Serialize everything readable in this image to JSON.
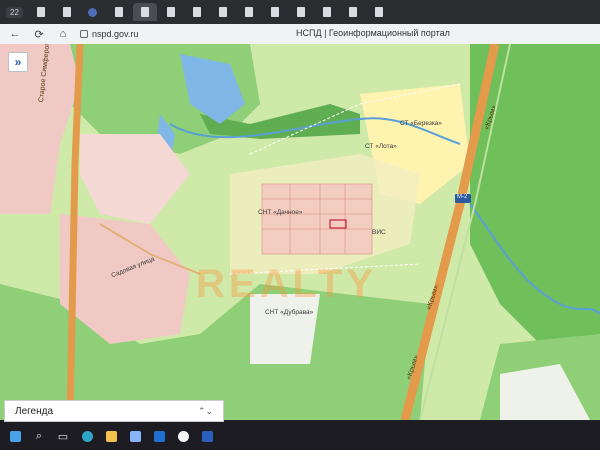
{
  "browser": {
    "tab_counter": "22",
    "tabs": [
      "pdf-tab",
      "word-tab",
      "app-tab",
      "word-tab",
      "word-tab",
      "pdf-tab",
      "pdf-tab",
      "pdf-tab",
      "pdf-tab",
      "pdf-tab",
      "pdf-tab",
      "pdf-tab",
      "pdf-tab",
      "pdf-tab"
    ],
    "url": "nspd.gov.ru",
    "page_title": "НСПД | Геоинформационный портал"
  },
  "map": {
    "labels": {
      "highway_west": "Старое Симферопольское шоссе",
      "street": "Садовая улица",
      "snt_dachnoe": "СНТ «Дачное»",
      "snt_dubrava": "СНТ «Дубрава»",
      "st_lota": "СТ «Лота»",
      "st_berezka": "СТ «Березка»",
      "area_label": "ВИС",
      "road_krym_1": "«Крым»",
      "road_krym_2": "«Крым»",
      "road_krym_3": "«Крым»",
      "road_shield": "М-2"
    },
    "watermark": "REALTY",
    "colors": {
      "forest": "#8fcf78",
      "meadow": "#cfe9a9",
      "water": "#7fb7e6",
      "settlement": "#f0c9c4",
      "road": "#e39a4a",
      "garden_zone": "#fff3b0"
    }
  },
  "legend": {
    "label": "Легенда",
    "chevron": "⌃⌄"
  },
  "taskbar": {
    "icons": [
      "windows-icon",
      "search-icon",
      "taskview-icon",
      "edge-icon",
      "explorer-icon",
      "photos-icon",
      "outlook-icon",
      "yandex-icon",
      "word-icon"
    ]
  }
}
